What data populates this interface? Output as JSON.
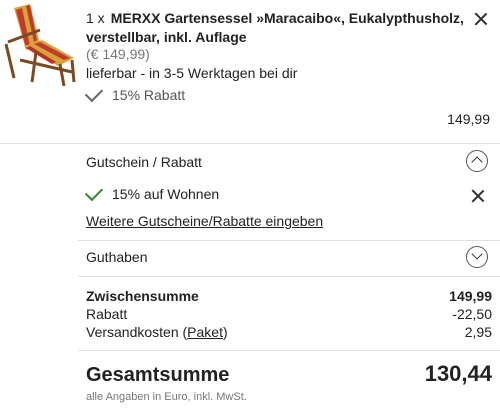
{
  "item": {
    "quantity": "1 x",
    "title_line1": "MERXX Gartensessel »Maracaibo«, Eukalypthusholz,",
    "title_line2": "verstellbar, inkl. Auflage",
    "old_price": "(€ 149,99)",
    "availability": "lieferbar - in 3-5 Werktagen bei dir",
    "discount_badge": "15% Rabatt",
    "price": "149,99",
    "image": "garden-lounge-chair-with-striped-cushion"
  },
  "voucher": {
    "label": "Gutschein / Rabatt",
    "applied": "15% auf Wohnen",
    "more_link": "Weitere Gutscheine/Rabatte eingeben"
  },
  "credit": {
    "label": "Guthaben"
  },
  "summary": {
    "subtotal_label": "Zwischensumme",
    "subtotal_value": "149,99",
    "discount_label": "Rabatt",
    "discount_value": "-22,50",
    "shipping_label_prefix": "Versandkosten (",
    "shipping_link": "Paket",
    "shipping_label_suffix": ")",
    "shipping_value": "2,95"
  },
  "total": {
    "label": "Gesamtsumme",
    "value": "130,44",
    "note": "alle Angaben in Euro, inkl. MwSt."
  },
  "colors": {
    "check_green": "#2e8b2e",
    "divider": "#e0e0e0"
  }
}
